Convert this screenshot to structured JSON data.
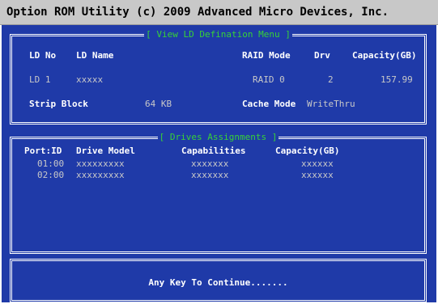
{
  "title_bar": "Option ROM Utility (c) 2009 Advanced Micro Devices, Inc.",
  "ld_panel": {
    "title": "[ View LD Defination Menu ]",
    "headers": {
      "ld_no": "LD No",
      "ld_name": "LD Name",
      "raid_mode": "RAID Mode",
      "drv": "Drv",
      "capacity": "Capacity(GB)"
    },
    "row": {
      "ld_no": "LD  1",
      "ld_name": "xxxxx",
      "raid_mode": "RAID 0",
      "drv": "2",
      "capacity": "157.99"
    },
    "strip_block_label": "Strip Block",
    "strip_block_value": "64 KB",
    "cache_mode_label": "Cache Mode",
    "cache_mode_value": "WriteThru"
  },
  "drives_panel": {
    "title": "[ Drives Assignments ]",
    "headers": {
      "port": "Port:ID",
      "model": "Drive Model",
      "capabilities": "Capabilities",
      "capacity": "Capacity(GB)"
    },
    "rows": [
      {
        "port": "01:00",
        "model": "xxxxxxxxx",
        "capabilities": "xxxxxxx",
        "capacity": "xxxxxx"
      },
      {
        "port": "02:00",
        "model": "xxxxxxxxx",
        "capabilities": "xxxxxxx",
        "capacity": "xxxxxx"
      }
    ]
  },
  "footer": {
    "continue_text": "Any Key To Continue......."
  },
  "colors": {
    "background": "#1f3aa8",
    "title_text": "#37d237",
    "header_text": "#ffffff",
    "value_text": "#c8c8c8",
    "titlebar_bg": "#c8c8c8"
  }
}
